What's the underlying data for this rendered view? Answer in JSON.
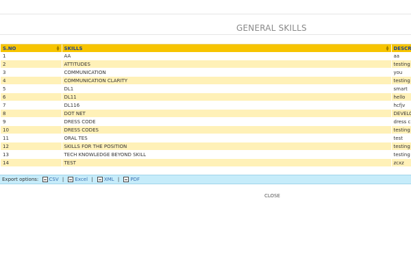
{
  "page": {
    "title": "GENERAL SKILLS"
  },
  "table": {
    "columns": [
      "S.NO",
      "SKILLS",
      "DESCR"
    ],
    "rows": [
      {
        "sno": "1",
        "skill": "AA",
        "desc": "aa"
      },
      {
        "sno": "2",
        "skill": "ATTITUDES",
        "desc": "testing"
      },
      {
        "sno": "3",
        "skill": "COMMUNICATION",
        "desc": "you"
      },
      {
        "sno": "4",
        "skill": "COMMUNICATION CLARITY",
        "desc": "testing"
      },
      {
        "sno": "5",
        "skill": "DL1",
        "desc": "smart"
      },
      {
        "sno": "6",
        "skill": "DL11",
        "desc": "hello"
      },
      {
        "sno": "7",
        "skill": "DL116",
        "desc": "hcfjv"
      },
      {
        "sno": "8",
        "skill": "DOT NET",
        "desc": "DEVELO"
      },
      {
        "sno": "9",
        "skill": "DRESS CODE",
        "desc": "dress c"
      },
      {
        "sno": "10",
        "skill": "DRESS CODES",
        "desc": "testing"
      },
      {
        "sno": "11",
        "skill": "ORAL TES",
        "desc": "test"
      },
      {
        "sno": "12",
        "skill": "SKILLS FOR THE POSITION",
        "desc": "testing"
      },
      {
        "sno": "13",
        "skill": "TECH KNOWLEDGE BEYOND SKILL",
        "desc": "testing"
      },
      {
        "sno": "14",
        "skill": "TEST",
        "desc": "zcxz"
      }
    ]
  },
  "export": {
    "label": "Export options:",
    "separator": "|",
    "options": [
      {
        "label": "CSV",
        "icon": "csv-icon"
      },
      {
        "label": "Excel",
        "icon": "excel-icon"
      },
      {
        "label": "XML",
        "icon": "xml-icon"
      },
      {
        "label": "PDF",
        "icon": "pdf-icon"
      }
    ]
  },
  "close_label": "CLOSE"
}
